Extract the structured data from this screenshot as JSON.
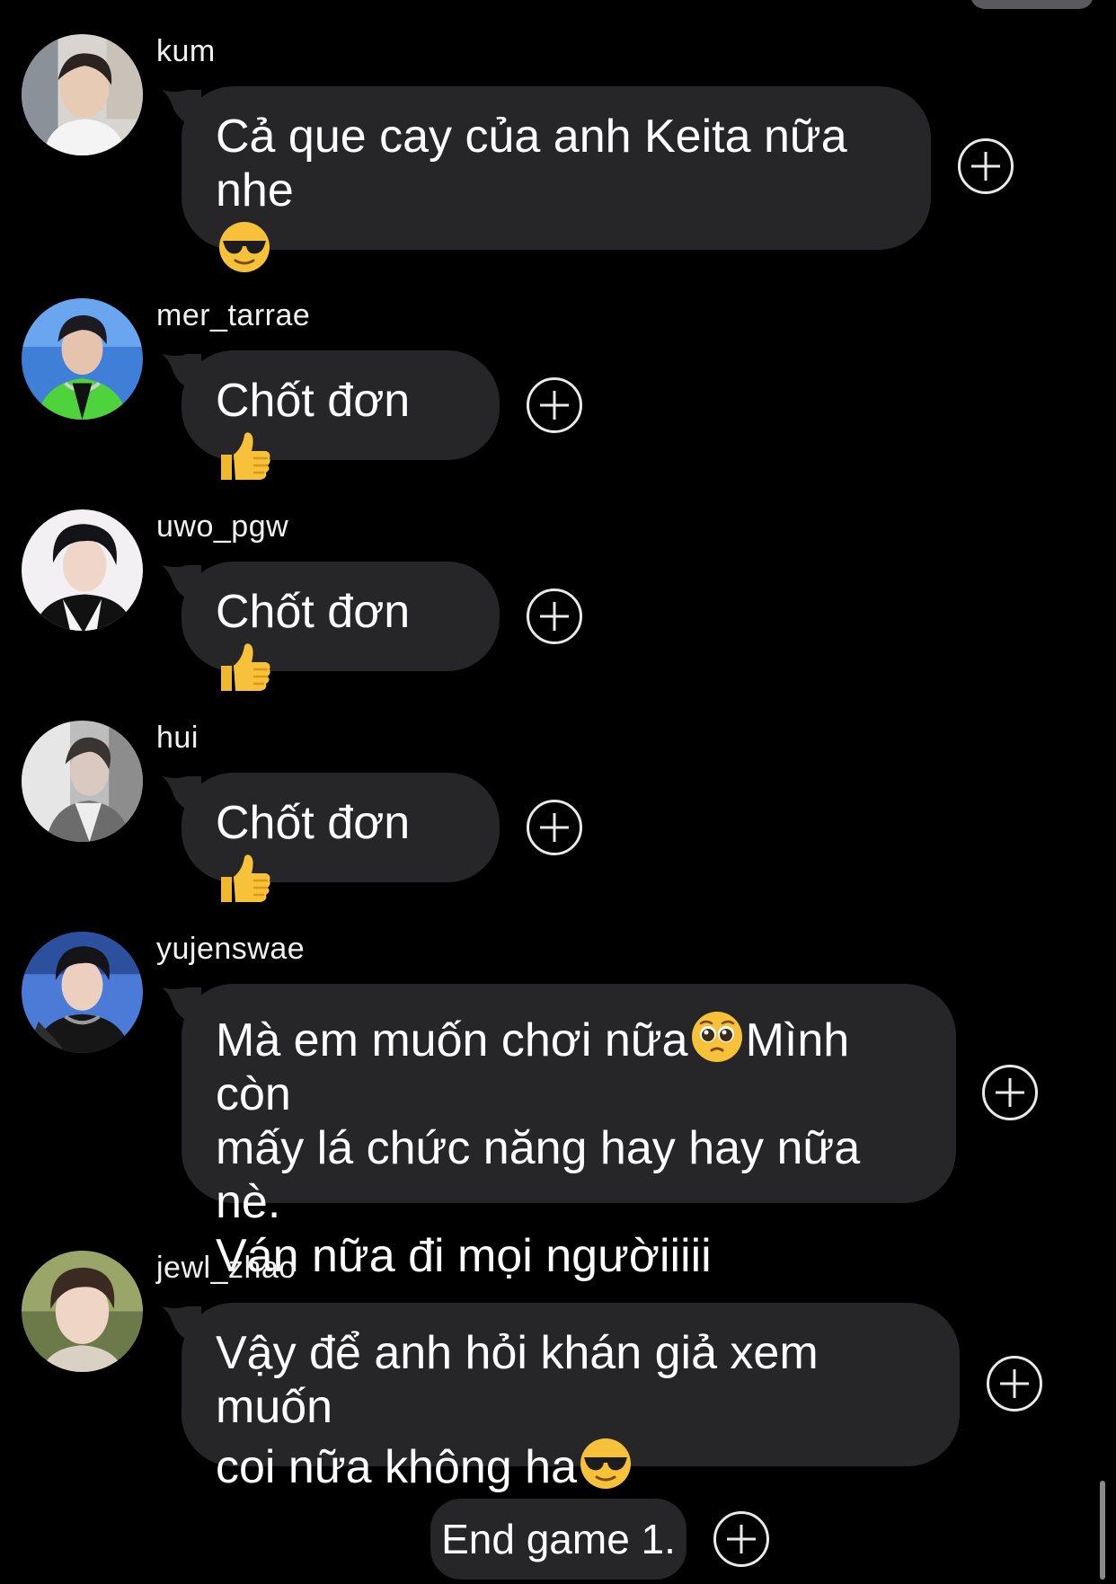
{
  "messages": [
    {
      "username": "kum",
      "lines": [
        "Cả que cay của anh Keita nữa nhe"
      ],
      "trailing_emoji": "smiling-face-with-sunglasses"
    },
    {
      "username": "mer_tarrae",
      "text": "Chốt đơn",
      "trailing_emoji": "thumbs-up"
    },
    {
      "username": "uwo_pgw",
      "text": "Chốt đơn",
      "trailing_emoji": "thumbs-up"
    },
    {
      "username": "hui",
      "text": "Chốt đơn",
      "trailing_emoji": "thumbs-up"
    },
    {
      "username": "yujenswae",
      "line1_a": "Mà em muốn chơi nữa",
      "line1_b": "Mình còn",
      "line2": "mấy lá chức năng hay hay nữa nè.",
      "line3": "Ván nữa đi mọi ngườiiiii",
      "inline_emoji": "pleading-face"
    },
    {
      "username": "jewl_zhao",
      "line1": "Vậy để anh hỏi khán giả xem muốn",
      "line2": "coi nữa không ha",
      "trailing_emoji": "smiling-face-with-sunglasses"
    }
  ],
  "system_message": {
    "text": "End game 1."
  },
  "icons": {
    "add_reaction": "add-reaction-icon"
  },
  "colors": {
    "background": "#000000",
    "bubble": "#262628",
    "text": "#ffffff"
  }
}
